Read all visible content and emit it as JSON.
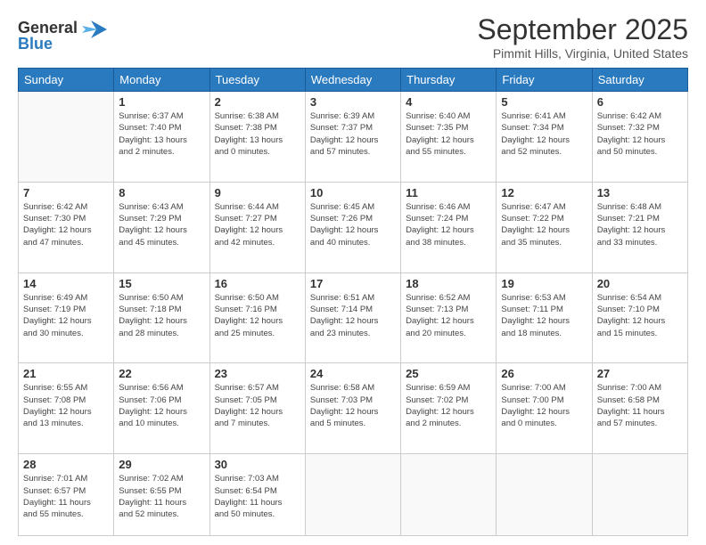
{
  "header": {
    "logo_line1": "General",
    "logo_line2": "Blue",
    "month": "September 2025",
    "location": "Pimmit Hills, Virginia, United States"
  },
  "weekdays": [
    "Sunday",
    "Monday",
    "Tuesday",
    "Wednesday",
    "Thursday",
    "Friday",
    "Saturday"
  ],
  "weeks": [
    [
      {
        "day": "",
        "info": ""
      },
      {
        "day": "1",
        "info": "Sunrise: 6:37 AM\nSunset: 7:40 PM\nDaylight: 13 hours\nand 2 minutes."
      },
      {
        "day": "2",
        "info": "Sunrise: 6:38 AM\nSunset: 7:38 PM\nDaylight: 13 hours\nand 0 minutes."
      },
      {
        "day": "3",
        "info": "Sunrise: 6:39 AM\nSunset: 7:37 PM\nDaylight: 12 hours\nand 57 minutes."
      },
      {
        "day": "4",
        "info": "Sunrise: 6:40 AM\nSunset: 7:35 PM\nDaylight: 12 hours\nand 55 minutes."
      },
      {
        "day": "5",
        "info": "Sunrise: 6:41 AM\nSunset: 7:34 PM\nDaylight: 12 hours\nand 52 minutes."
      },
      {
        "day": "6",
        "info": "Sunrise: 6:42 AM\nSunset: 7:32 PM\nDaylight: 12 hours\nand 50 minutes."
      }
    ],
    [
      {
        "day": "7",
        "info": "Sunrise: 6:42 AM\nSunset: 7:30 PM\nDaylight: 12 hours\nand 47 minutes."
      },
      {
        "day": "8",
        "info": "Sunrise: 6:43 AM\nSunset: 7:29 PM\nDaylight: 12 hours\nand 45 minutes."
      },
      {
        "day": "9",
        "info": "Sunrise: 6:44 AM\nSunset: 7:27 PM\nDaylight: 12 hours\nand 42 minutes."
      },
      {
        "day": "10",
        "info": "Sunrise: 6:45 AM\nSunset: 7:26 PM\nDaylight: 12 hours\nand 40 minutes."
      },
      {
        "day": "11",
        "info": "Sunrise: 6:46 AM\nSunset: 7:24 PM\nDaylight: 12 hours\nand 38 minutes."
      },
      {
        "day": "12",
        "info": "Sunrise: 6:47 AM\nSunset: 7:22 PM\nDaylight: 12 hours\nand 35 minutes."
      },
      {
        "day": "13",
        "info": "Sunrise: 6:48 AM\nSunset: 7:21 PM\nDaylight: 12 hours\nand 33 minutes."
      }
    ],
    [
      {
        "day": "14",
        "info": "Sunrise: 6:49 AM\nSunset: 7:19 PM\nDaylight: 12 hours\nand 30 minutes."
      },
      {
        "day": "15",
        "info": "Sunrise: 6:50 AM\nSunset: 7:18 PM\nDaylight: 12 hours\nand 28 minutes."
      },
      {
        "day": "16",
        "info": "Sunrise: 6:50 AM\nSunset: 7:16 PM\nDaylight: 12 hours\nand 25 minutes."
      },
      {
        "day": "17",
        "info": "Sunrise: 6:51 AM\nSunset: 7:14 PM\nDaylight: 12 hours\nand 23 minutes."
      },
      {
        "day": "18",
        "info": "Sunrise: 6:52 AM\nSunset: 7:13 PM\nDaylight: 12 hours\nand 20 minutes."
      },
      {
        "day": "19",
        "info": "Sunrise: 6:53 AM\nSunset: 7:11 PM\nDaylight: 12 hours\nand 18 minutes."
      },
      {
        "day": "20",
        "info": "Sunrise: 6:54 AM\nSunset: 7:10 PM\nDaylight: 12 hours\nand 15 minutes."
      }
    ],
    [
      {
        "day": "21",
        "info": "Sunrise: 6:55 AM\nSunset: 7:08 PM\nDaylight: 12 hours\nand 13 minutes."
      },
      {
        "day": "22",
        "info": "Sunrise: 6:56 AM\nSunset: 7:06 PM\nDaylight: 12 hours\nand 10 minutes."
      },
      {
        "day": "23",
        "info": "Sunrise: 6:57 AM\nSunset: 7:05 PM\nDaylight: 12 hours\nand 7 minutes."
      },
      {
        "day": "24",
        "info": "Sunrise: 6:58 AM\nSunset: 7:03 PM\nDaylight: 12 hours\nand 5 minutes."
      },
      {
        "day": "25",
        "info": "Sunrise: 6:59 AM\nSunset: 7:02 PM\nDaylight: 12 hours\nand 2 minutes."
      },
      {
        "day": "26",
        "info": "Sunrise: 7:00 AM\nSunset: 7:00 PM\nDaylight: 12 hours\nand 0 minutes."
      },
      {
        "day": "27",
        "info": "Sunrise: 7:00 AM\nSunset: 6:58 PM\nDaylight: 11 hours\nand 57 minutes."
      }
    ],
    [
      {
        "day": "28",
        "info": "Sunrise: 7:01 AM\nSunset: 6:57 PM\nDaylight: 11 hours\nand 55 minutes."
      },
      {
        "day": "29",
        "info": "Sunrise: 7:02 AM\nSunset: 6:55 PM\nDaylight: 11 hours\nand 52 minutes."
      },
      {
        "day": "30",
        "info": "Sunrise: 7:03 AM\nSunset: 6:54 PM\nDaylight: 11 hours\nand 50 minutes."
      },
      {
        "day": "",
        "info": ""
      },
      {
        "day": "",
        "info": ""
      },
      {
        "day": "",
        "info": ""
      },
      {
        "day": "",
        "info": ""
      }
    ]
  ]
}
